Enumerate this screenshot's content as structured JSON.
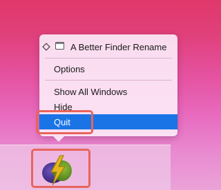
{
  "context_menu": {
    "app_name": "A Better Finder Rename",
    "items": {
      "options": "Options",
      "show_all_windows": "Show All Windows",
      "hide": "Hide",
      "quit": "Quit"
    },
    "selected_item": "Quit"
  },
  "dock": {
    "app_icon_name": "a-better-finder-rename-icon"
  },
  "colors": {
    "selection": "#1a74e6",
    "highlight_box": "#e8645a",
    "icon_purple": "#4a3590",
    "icon_bolt": "#e0b818"
  }
}
